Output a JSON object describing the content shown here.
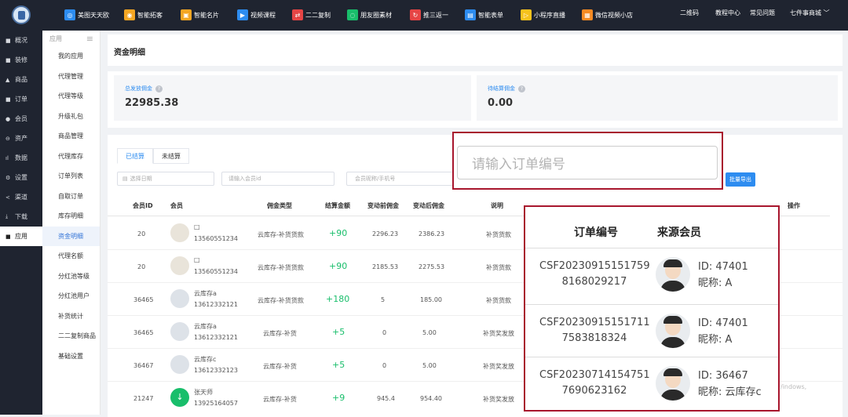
{
  "topnav": {
    "items": [
      {
        "label": "美图天天欧",
        "color": "#2d8cf0",
        "glyph": "◎"
      },
      {
        "label": "智能拓客",
        "color": "#f5a623",
        "glyph": "◉"
      },
      {
        "label": "智能名片",
        "color": "#f5a623",
        "glyph": "▣"
      },
      {
        "label": "视频课程",
        "color": "#2d8cf0",
        "glyph": "▶"
      },
      {
        "label": "二二复制",
        "color": "#e64545",
        "glyph": "⇄"
      },
      {
        "label": "朋友圈素材",
        "color": "#19be6b",
        "glyph": "◌"
      },
      {
        "label": "推三返一",
        "color": "#e64545",
        "glyph": "↻"
      },
      {
        "label": "智能表单",
        "color": "#2d8cf0",
        "glyph": "▤"
      },
      {
        "label": "小程序直播",
        "color": "#f7c21d",
        "glyph": "▷"
      },
      {
        "label": "微信视频小店",
        "color": "#f58a23",
        "glyph": "▦"
      }
    ],
    "right": [
      "二维码",
      "教程中心",
      "常见问题",
      "七件事商城 ﹀"
    ]
  },
  "sidebar": {
    "items": [
      {
        "label": "概况",
        "icon": "■"
      },
      {
        "label": "装修",
        "icon": "■"
      },
      {
        "label": "商品",
        "icon": "▲"
      },
      {
        "label": "订单",
        "icon": "■"
      },
      {
        "label": "会员",
        "icon": "●"
      },
      {
        "label": "资产",
        "icon": "⊖"
      },
      {
        "label": "数据",
        "icon": "ıl"
      },
      {
        "label": "设置",
        "icon": "⚙"
      },
      {
        "label": "渠道",
        "icon": "<"
      },
      {
        "label": "下载",
        "icon": "⤓"
      },
      {
        "label": "应用",
        "icon": "■"
      }
    ]
  },
  "subside": {
    "title": "应用",
    "menu_icon": "≡",
    "items": [
      "我的应用",
      "代理管理",
      "代理等级",
      "升级礼包",
      "商品管理",
      "代理库存",
      "订单列表",
      "自取订单",
      "库存明细",
      "资金明细",
      "代理名额",
      "分红池等级",
      "分红池用户",
      "补货统计",
      "二二复制商品",
      "基础设置"
    ]
  },
  "page": {
    "title": "资金明细"
  },
  "stats": [
    {
      "label": "总发放佣金",
      "value": "22985.38",
      "q": "?"
    },
    {
      "label": "待结算佣金",
      "value": "0.00",
      "q": "?"
    }
  ],
  "tabs": [
    "已结算",
    "未结算"
  ],
  "filters": {
    "date": "选择日期",
    "member": "请输入会员id",
    "phone": "会员昵称/手机号"
  },
  "search": {
    "placeholder": "请输入订单编号"
  },
  "export_label": "批量导出",
  "columns": [
    "会员ID",
    "会员",
    "佣金类型",
    "结算金额",
    "变动前佣金",
    "变动后佣金",
    "说明",
    "操作"
  ],
  "rows": [
    {
      "id": "20",
      "name": "□",
      "phone": "13560551234",
      "type": "云库存-补货货款",
      "amount": "+90",
      "before": "2296.23",
      "after": "2386.23",
      "note": "补货货款"
    },
    {
      "id": "20",
      "name": "□",
      "phone": "13560551234",
      "type": "云库存-补货货款",
      "amount": "+90",
      "before": "2185.53",
      "after": "2275.53",
      "note": "补货货款"
    },
    {
      "id": "36465",
      "name": "云库存a",
      "phone": "13612332121",
      "type": "云库存-补货货款",
      "amount": "+180",
      "before": "5",
      "after": "185.00",
      "note": "补货货款"
    },
    {
      "id": "36465",
      "name": "云库存a",
      "phone": "13612332121",
      "type": "云库存-补货",
      "amount": "+5",
      "before": "0",
      "after": "5.00",
      "note": "补货奖发放"
    },
    {
      "id": "36467",
      "name": "云库存c",
      "phone": "13612332123",
      "type": "云库存-补货",
      "amount": "+5",
      "before": "0",
      "after": "5.00",
      "note": "补货奖发放"
    },
    {
      "id": "21247",
      "name": "张天师",
      "phone": "13925164057",
      "type": "云库存-补货",
      "amount": "+9",
      "before": "945.4",
      "after": "954.40",
      "note": "补货奖发放"
    }
  ],
  "popup": {
    "col_order": "订单编号",
    "col_member": "来源会员",
    "rows": [
      {
        "order1": "CSF20230915151759",
        "order2": "8168029217",
        "id": "ID:  47401",
        "nick": "昵称:  A"
      },
      {
        "order1": "CSF20230915151711",
        "order2": "7583818324",
        "id": "ID:  47401",
        "nick": "昵称:  A"
      },
      {
        "order1": "CSF20230714154751",
        "order2": "7690623162",
        "id": "ID:  36467",
        "nick": "昵称:  云库存c"
      }
    ]
  },
  "watermark": "/indows,"
}
